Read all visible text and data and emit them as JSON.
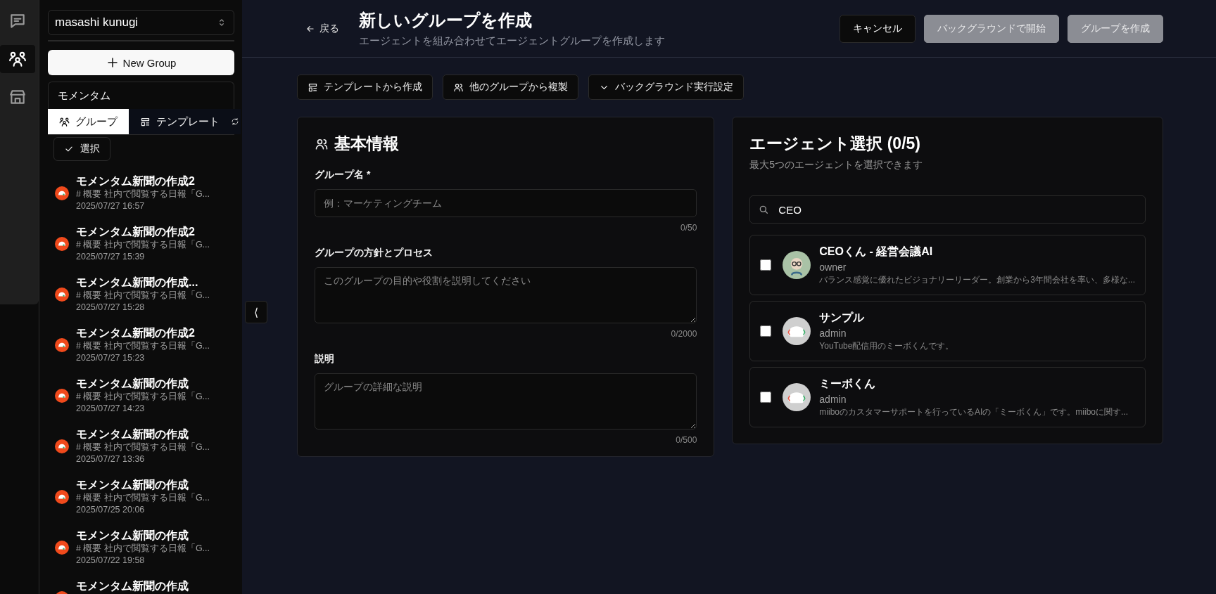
{
  "rail": [
    {
      "kind": "chat",
      "selected": false
    },
    {
      "kind": "group",
      "selected": true
    },
    {
      "kind": "store",
      "selected": false
    }
  ],
  "sidebar": {
    "account": "masashi kunugi",
    "new_button": "New Group",
    "search": {
      "value": "モメンタム"
    },
    "tabs": [
      {
        "label": "グループ",
        "kind": "group",
        "selected": true
      },
      {
        "label": "テンプレート",
        "kind": "template",
        "selected": false
      }
    ],
    "select_button": "選択",
    "items": [
      {
        "title": "モメンタム新聞の作成2",
        "snippet": "# 概要 社内で閲覧する日報「G...",
        "date": "2025/07/27 16:57"
      },
      {
        "title": "モメンタム新聞の作成2",
        "snippet": "# 概要 社内で閲覧する日報「G...",
        "date": "2025/07/27 15:39"
      },
      {
        "title": "モメンタム新聞の作成...",
        "snippet": "# 概要 社内で閲覧する日報「G...",
        "date": "2025/07/27 15:28"
      },
      {
        "title": "モメンタム新聞の作成2",
        "snippet": "# 概要 社内で閲覧する日報「G...",
        "date": "2025/07/27 15:23"
      },
      {
        "title": "モメンタム新聞の作成",
        "snippet": "# 概要 社内で閲覧する日報「G...",
        "date": "2025/07/27 14:23"
      },
      {
        "title": "モメンタム新聞の作成",
        "snippet": "# 概要 社内で閲覧する日報「G...",
        "date": "2025/07/27 13:36"
      },
      {
        "title": "モメンタム新聞の作成",
        "snippet": "# 概要 社内で閲覧する日報「G...",
        "date": "2025/07/25 20:06"
      },
      {
        "title": "モメンタム新聞の作成",
        "snippet": "# 概要 社内で閲覧する日報「G...",
        "date": "2025/07/22 19:58"
      },
      {
        "title": "モメンタム新聞の作成"
      }
    ]
  },
  "collapse_button": "⟨",
  "header": {
    "back": "戻る",
    "title": "新しいグループを作成",
    "subtitle": "エージェントを組み合わせてエージェントグループを作成します",
    "buttons": [
      {
        "label": "キャンセル",
        "disabled": false
      },
      {
        "label": "バックグラウンドで開始",
        "disabled": true
      },
      {
        "label": "グループを作成",
        "disabled": true
      }
    ]
  },
  "toolbar": [
    {
      "label": "テンプレートから作成",
      "kind": "template"
    },
    {
      "label": "他のグループから複製",
      "kind": "users"
    },
    {
      "label": "バックグラウンド実行設定",
      "kind": "chevron"
    }
  ],
  "basic_info": {
    "title": "基本情報",
    "fields": [
      {
        "label": "グループ名 *",
        "kind": "input",
        "placeholder": "例：マーケティングチーム",
        "count": "0/50"
      },
      {
        "label": "グループの方針とプロセス",
        "kind": "textarea",
        "placeholder": "このグループの目的や役割を説明してください",
        "count": "0/2000"
      },
      {
        "label": "説明",
        "kind": "textarea",
        "placeholder": "グループの詳細な説明",
        "count": "0/500"
      }
    ]
  },
  "agent_select": {
    "title": "エージェント選択 (0/5)",
    "subtitle": "最大5つのエージェントを選択できます",
    "search": {
      "value": "CEO"
    },
    "agents": [
      {
        "name": "CEOくん - 経営会議AI",
        "role": "owner",
        "description": "バランス感覚に優れたビジョナリーリーダー。創業から3年間会社を率い、多様な...",
        "checked": false,
        "kind": "person"
      },
      {
        "name": "サンプル",
        "role": "admin",
        "description": "YouTube配信用のミーボくんです。",
        "checked": false,
        "kind": "mascot"
      },
      {
        "name": "ミーボくん",
        "role": "admin",
        "description": "miiboのカスタマーサポートを行っているAIの「ミーボくん」です。miiboに関す...",
        "checked": false,
        "kind": "mascot"
      }
    ]
  }
}
